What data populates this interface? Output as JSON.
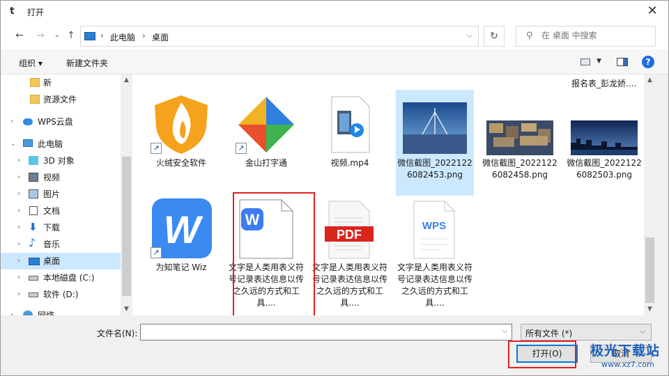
{
  "window": {
    "title": "打开",
    "app_icon": "t",
    "close_glyph": "✕"
  },
  "nav": {
    "back": "←",
    "forward": "→",
    "history": "⌄",
    "up": "↑",
    "breadcrumb": [
      "此电脑",
      "桌面"
    ],
    "refresh": "↻",
    "search_placeholder": "在 桌面 中搜索"
  },
  "toolbar": {
    "organize": "组织 ▾",
    "new_folder": "新建文件夹",
    "help": "?"
  },
  "sidebar": {
    "items": [
      {
        "label": "新",
        "icon": "folder-icon"
      },
      {
        "label": "资源文件",
        "icon": "folder-icon"
      },
      {
        "label": "WPS云盘",
        "icon": "cloud-icon"
      },
      {
        "label": "此电脑",
        "icon": "computer-icon"
      },
      {
        "label": "3D 对象",
        "icon": "cube-icon"
      },
      {
        "label": "视频",
        "icon": "video-icon"
      },
      {
        "label": "图片",
        "icon": "picture-icon"
      },
      {
        "label": "文档",
        "icon": "document-icon"
      },
      {
        "label": "下载",
        "icon": "download-icon"
      },
      {
        "label": "音乐",
        "icon": "music-icon"
      },
      {
        "label": "桌面",
        "icon": "desktop-icon"
      },
      {
        "label": "本地磁盘 (C:)",
        "icon": "drive-icon"
      },
      {
        "label": "软件 (D:)",
        "icon": "drive-icon"
      },
      {
        "label": "网络",
        "icon": "network-icon"
      }
    ]
  },
  "files": {
    "top_label": "报名表_彭龙娇....",
    "items": [
      {
        "name": "火绒安全软件",
        "icon": "huorong-shield-icon"
      },
      {
        "name": "金山打字通",
        "icon": "kingsoft-typing-icon"
      },
      {
        "name": "视频.mp4",
        "icon": "video-file-icon"
      },
      {
        "name": "微信截图_20221226082453.png",
        "icon": "image-thumbnail-bridge"
      },
      {
        "name": "微信截图_20221226082458.png",
        "icon": "image-thumbnail-city"
      },
      {
        "name": "微信截图_20221226082503.png",
        "icon": "image-thumbnail-skyline"
      },
      {
        "name": "为知笔记 Wiz",
        "icon": "wiz-note-icon"
      },
      {
        "name": "文字是人类用表义符号记录表达信息以传之久远的方式和工具....",
        "icon": "wps-writer-doc-icon"
      },
      {
        "name": "文字是人类用表义符号记录表达信息以传之久远的方式和工具....",
        "icon": "pdf-file-icon"
      },
      {
        "name": "文字是人类用表义符号记录表达信息以传之久远的方式和工具....",
        "icon": "wps-file-icon"
      }
    ],
    "pdf_text": "PDF",
    "wps_text": "WPS",
    "w_text": "W"
  },
  "bottom": {
    "filename_label": "文件名(N):",
    "filename_value": "",
    "filetype": "所有文件 (*)",
    "open": "打开(O)",
    "cancel": "取消"
  },
  "watermark": {
    "line1": "极光下载站",
    "line2": "www.xz7.com"
  },
  "colors": {
    "accent": "#0078d7",
    "selection": "#cce8ff",
    "highlight": "#e02020"
  }
}
